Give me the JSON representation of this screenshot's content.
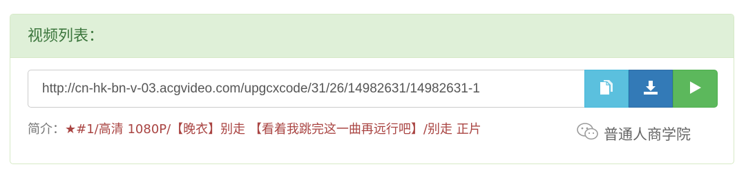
{
  "panel": {
    "title": "视频列表："
  },
  "video": {
    "url": "http://cn-hk-bn-v-03.acgvideo.com/upgcxcode/31/26/14982631/14982631-1",
    "buttons": {
      "copy_icon": "copy-icon",
      "download_icon": "download-icon",
      "play_icon": "play-icon"
    }
  },
  "intro": {
    "label": "简介：",
    "text": "★#1/高清 1080P/【晚衣】别走 【看着我跳完这一曲再远行吧】/别走 正片"
  },
  "watermark": {
    "text": "普通人商学院"
  },
  "colors": {
    "heading_bg": "#dff0d8",
    "heading_text": "#3c763d",
    "copy_btn": "#5bc0de",
    "download_btn": "#337ab7",
    "play_btn": "#5cb85c",
    "intro_text": "#a94442"
  }
}
